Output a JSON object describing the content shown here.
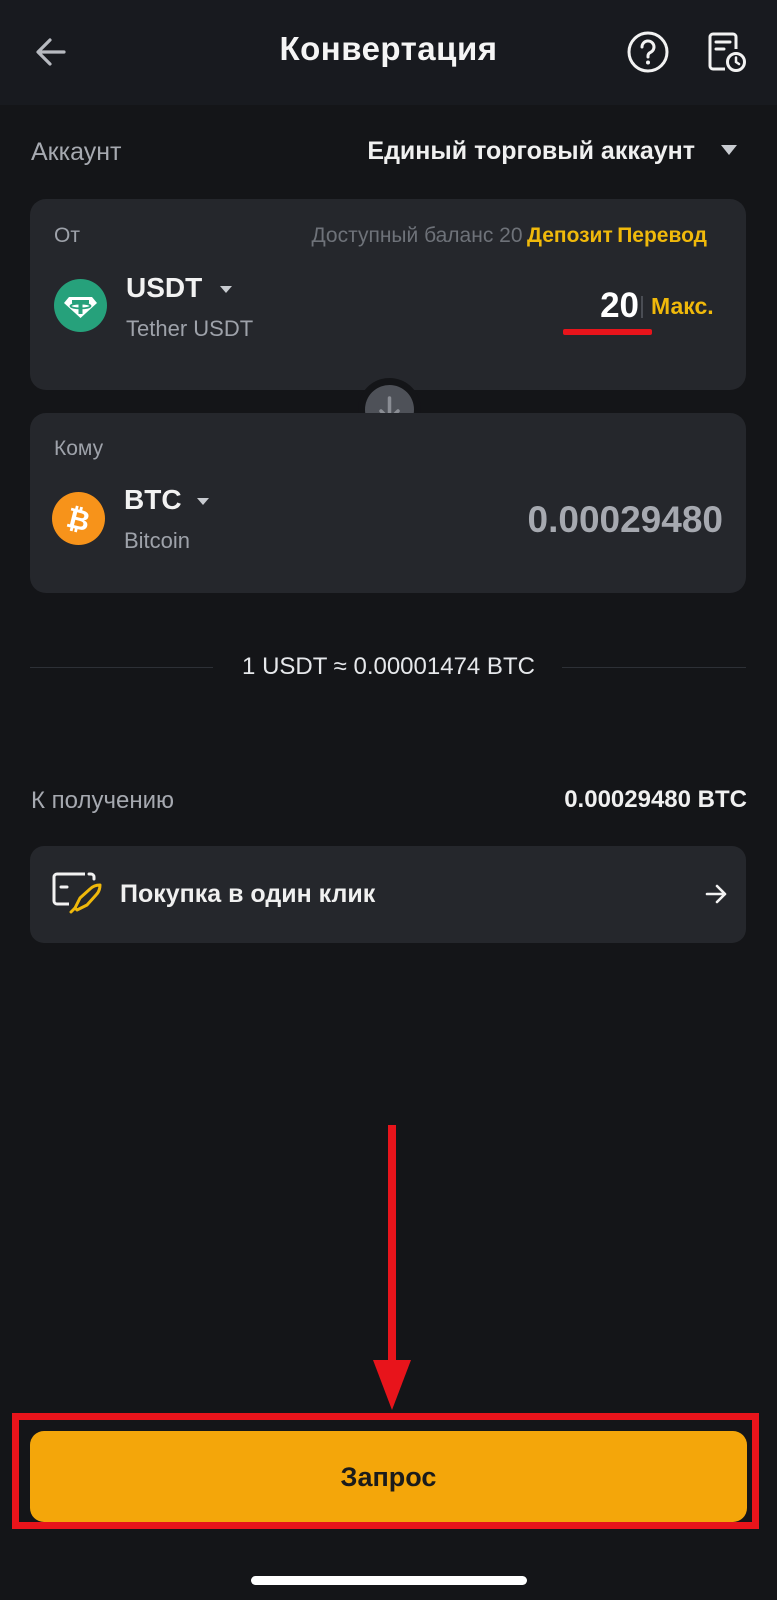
{
  "header": {
    "title": "Конвертация"
  },
  "account": {
    "label": "Аккаунт",
    "value": "Единый торговый аккаунт"
  },
  "from": {
    "label": "От",
    "balance_text": "Доступный баланс 20",
    "deposit_label": "Депозит",
    "transfer_label": "Перевод",
    "coin_symbol": "USDT",
    "coin_name": "Tether USDT",
    "amount": "20",
    "max_label": "Макс."
  },
  "to": {
    "label": "Кому",
    "coin_symbol": "BTC",
    "coin_name": "Bitcoin",
    "amount": "0.00029480"
  },
  "rate": {
    "text": "1 USDT ≈ 0.00001474 BTC"
  },
  "receive": {
    "label": "К получению",
    "value": "0.00029480 BTC"
  },
  "oneclick": {
    "label": "Покупка в один клик"
  },
  "request": {
    "label": "Запрос"
  },
  "colors": {
    "accent": "#f0b90b",
    "button": "#f4a60a",
    "highlight": "#e8141b",
    "usdt": "#26a17b",
    "btc": "#f7931a"
  },
  "icons": [
    "back-arrow-icon",
    "help-icon",
    "history-icon",
    "usdt-coin-icon",
    "btc-coin-icon",
    "swap-arrow-icon",
    "rocket-card-icon",
    "arrow-right-icon"
  ]
}
